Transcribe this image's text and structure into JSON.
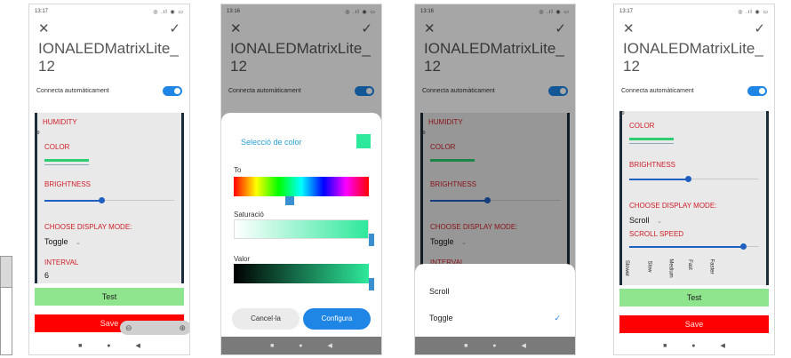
{
  "app": {
    "device_title": "IONALEDMatrixLite_\n12",
    "autoconnect_label": "Connecta automàticament",
    "close_glyph": "✕",
    "check_glyph": "✓"
  },
  "screens": [
    {
      "time": "13:17",
      "labels": {
        "humidity": "HUMIDITY",
        "color": "COLOR",
        "brightness": "BRIGHTNESS",
        "mode": "CHOOSE DISPLAY MODE:",
        "mode_value": "Toggle",
        "interval": "INTERVAL",
        "interval_value": "6",
        "small_num": "39"
      },
      "brightness_level": 0.55,
      "test": "Test",
      "save": "Save",
      "zoom": {
        "minus": "⊖",
        "plus": "⊕"
      }
    },
    {
      "time": "13:16",
      "picker": {
        "title": "Selecció de color",
        "hue": "To",
        "saturation": "Saturació",
        "value": "Valor",
        "cancel": "Cancel·la",
        "apply": "Configura",
        "swatch_color": "#2ee89b"
      }
    },
    {
      "time": "13:16",
      "options": [
        "Scroll",
        "Toggle"
      ],
      "selected_index": 1,
      "check": "✓"
    },
    {
      "time": "13:17",
      "labels": {
        "color": "COLOR",
        "brightness": "BRIGHTNESS",
        "mode": "CHOOSE DISPLAY MODE:",
        "mode_value": "Scroll",
        "scroll_speed": "SCROLL SPEED",
        "speeds": [
          "Slower",
          "Slow",
          "Medium",
          "Fast",
          "Faster"
        ],
        "small_num": "39"
      },
      "brightness_level": 0.45,
      "scroll_speed_level": 0.9,
      "test": "Test",
      "save": "Save"
    }
  ],
  "colors": {
    "accent": "#1f86e6",
    "label_red": "#d0202a",
    "test_green": "#8ee58e",
    "save_red": "#ff0000",
    "led_green": "#2ecc71"
  }
}
